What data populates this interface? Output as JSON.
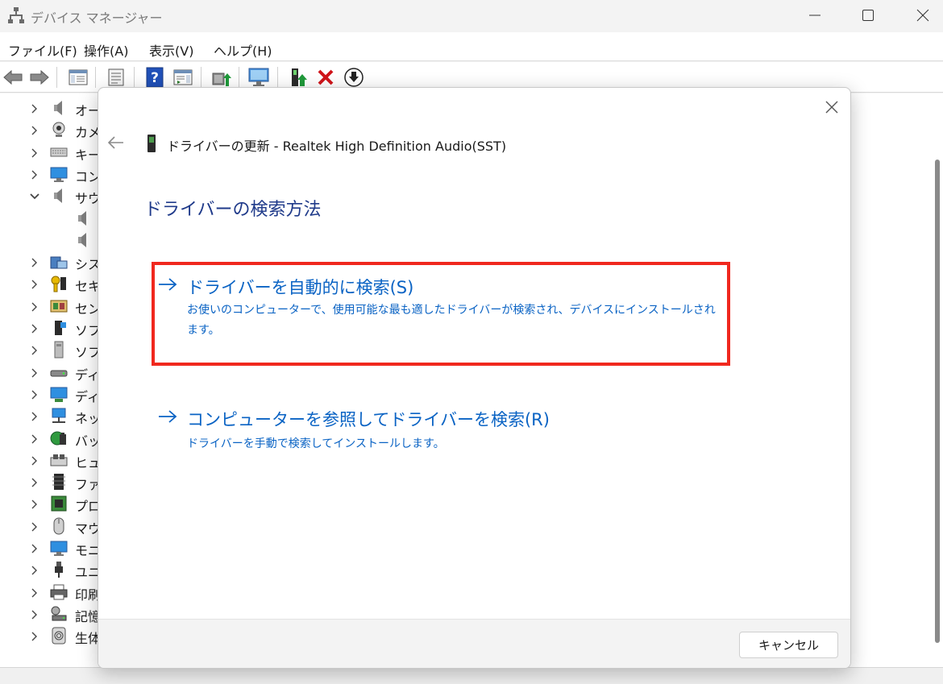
{
  "window": {
    "title": "デバイス マネージャー",
    "controls": [
      "minimize-icon",
      "maximize-icon",
      "close-icon"
    ]
  },
  "menubar": {
    "items": [
      {
        "label": "ファイル(F)"
      },
      {
        "label": "操作(A)"
      },
      {
        "label": "表示(V)"
      },
      {
        "label": "ヘルプ(H)"
      }
    ]
  },
  "toolbar": {
    "buttons": [
      "back-arrow-icon",
      "forward-arrow-icon",
      "console-tree-icon",
      "properties-icon",
      "help-icon",
      "action-pane-icon",
      "update-driver-icon",
      "scan-hardware-icon",
      "enable-device-icon",
      "uninstall-device-icon",
      "download-driver-icon"
    ]
  },
  "device_tree": {
    "items": [
      {
        "label": "オー",
        "expanded": false,
        "icon": "speaker-icon"
      },
      {
        "label": "カメ",
        "expanded": false,
        "icon": "camera-icon"
      },
      {
        "label": "キー",
        "expanded": false,
        "icon": "keyboard-icon"
      },
      {
        "label": "コン",
        "expanded": false,
        "icon": "monitor-icon"
      },
      {
        "label": "サウ",
        "expanded": true,
        "icon": "speaker-icon"
      },
      {
        "label": "",
        "child": true,
        "icon": "speaker-icon"
      },
      {
        "label": "",
        "child": true,
        "icon": "speaker-icon"
      },
      {
        "label": "シス",
        "expanded": false,
        "icon": "system-device-icon"
      },
      {
        "label": "セキ",
        "expanded": false,
        "icon": "security-key-icon"
      },
      {
        "label": "セン",
        "expanded": false,
        "icon": "sensor-icon"
      },
      {
        "label": "ソフ",
        "expanded": false,
        "icon": "software-component-icon"
      },
      {
        "label": "ソフ",
        "expanded": false,
        "icon": "software-device-icon"
      },
      {
        "label": "ディ",
        "expanded": false,
        "icon": "disk-drive-icon"
      },
      {
        "label": "ディ",
        "expanded": false,
        "icon": "display-adapter-icon"
      },
      {
        "label": "ネッ",
        "expanded": false,
        "icon": "network-adapter-icon"
      },
      {
        "label": "バッ",
        "expanded": false,
        "icon": "battery-icon"
      },
      {
        "label": "ヒュ",
        "expanded": false,
        "icon": "hid-icon"
      },
      {
        "label": "ファ",
        "expanded": false,
        "icon": "firmware-icon"
      },
      {
        "label": "プロ",
        "expanded": false,
        "icon": "processor-icon"
      },
      {
        "label": "マウ",
        "expanded": false,
        "icon": "mouse-icon"
      },
      {
        "label": "モニ",
        "expanded": false,
        "icon": "monitor-icon"
      },
      {
        "label": "ユニ",
        "expanded": false,
        "icon": "usb-icon"
      },
      {
        "label": "印刷",
        "expanded": false,
        "icon": "printer-icon"
      },
      {
        "label": "記憶",
        "expanded": false,
        "icon": "storage-controller-icon"
      },
      {
        "label": "生体",
        "expanded": false,
        "icon": "biometric-icon"
      }
    ]
  },
  "dialog": {
    "title": "ドライバーの更新 - Realtek High Definition Audio(SST)",
    "heading": "ドライバーの検索方法",
    "option_auto": {
      "title": "ドライバーを自動的に検索(S)",
      "description": "お使いのコンピューターで、使用可能な最も適したドライバーが検索され、デバイスにインストールされます。"
    },
    "option_browse": {
      "title": "コンピューターを参照してドライバーを検索(R)",
      "description": "ドライバーを手動で検索してインストールします。"
    },
    "cancel_label": "キャンセル",
    "highlight_color": "#f0281e",
    "link_color": "#0a63c4"
  }
}
